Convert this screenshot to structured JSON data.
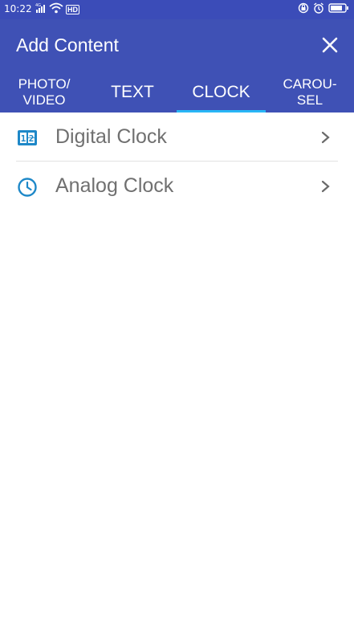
{
  "status_bar": {
    "time": "10:22",
    "network": "4G",
    "network_extra": "HD",
    "icons": [
      "signal-icon",
      "wifi-icon",
      "lock-rotation-icon",
      "alarm-icon",
      "battery-icon"
    ]
  },
  "app_bar": {
    "title": "Add Content",
    "close_icon": "close-icon"
  },
  "tabs": [
    {
      "line1": "PHOTO/",
      "line2": "VIDEO",
      "selected": false
    },
    {
      "label": "TEXT",
      "selected": false
    },
    {
      "label": "CLOCK",
      "selected": true
    },
    {
      "line1": "CAROU-",
      "line2": "SEL",
      "selected": false
    }
  ],
  "list": {
    "items": [
      {
        "label": "Digital Clock",
        "icon": "digital-clock-icon",
        "trailing_icon": "chevron-right-icon"
      },
      {
        "label": "Analog Clock",
        "icon": "analog-clock-icon",
        "trailing_icon": "chevron-right-icon"
      }
    ]
  },
  "colors": {
    "primary": "#3f51b5",
    "status_bar": "#3b4cb8",
    "tab_indicator": "#29b6f6",
    "icon_accent": "#1e88c8",
    "item_text": "#707070"
  }
}
